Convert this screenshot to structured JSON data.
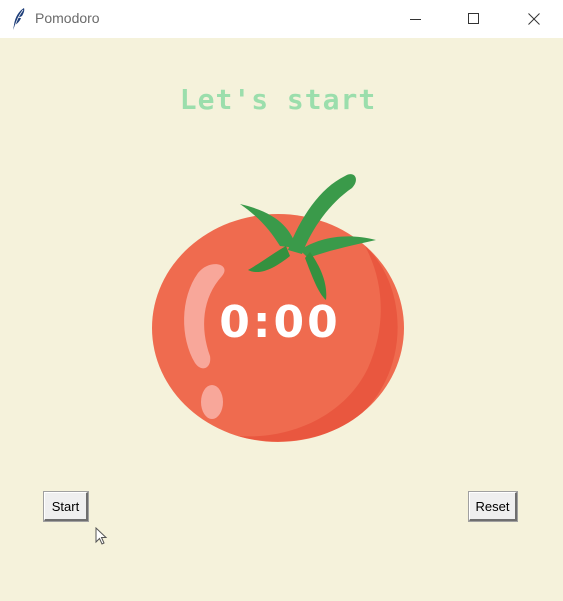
{
  "window": {
    "title": "Pomodoro",
    "icon": "feather-icon",
    "controls": [
      "minimize-icon",
      "maximize-icon",
      "close-icon"
    ]
  },
  "main": {
    "heading": "Let's start",
    "timer": "0:00",
    "image": "tomato-icon"
  },
  "buttons": {
    "start_label": "Start",
    "reset_label": "Reset"
  },
  "colors": {
    "background": "#f5f2db",
    "heading": "#9bdeac",
    "tomato": "#f06048",
    "leaf": "#3a9a4a",
    "timer_text": "#ffffff"
  }
}
